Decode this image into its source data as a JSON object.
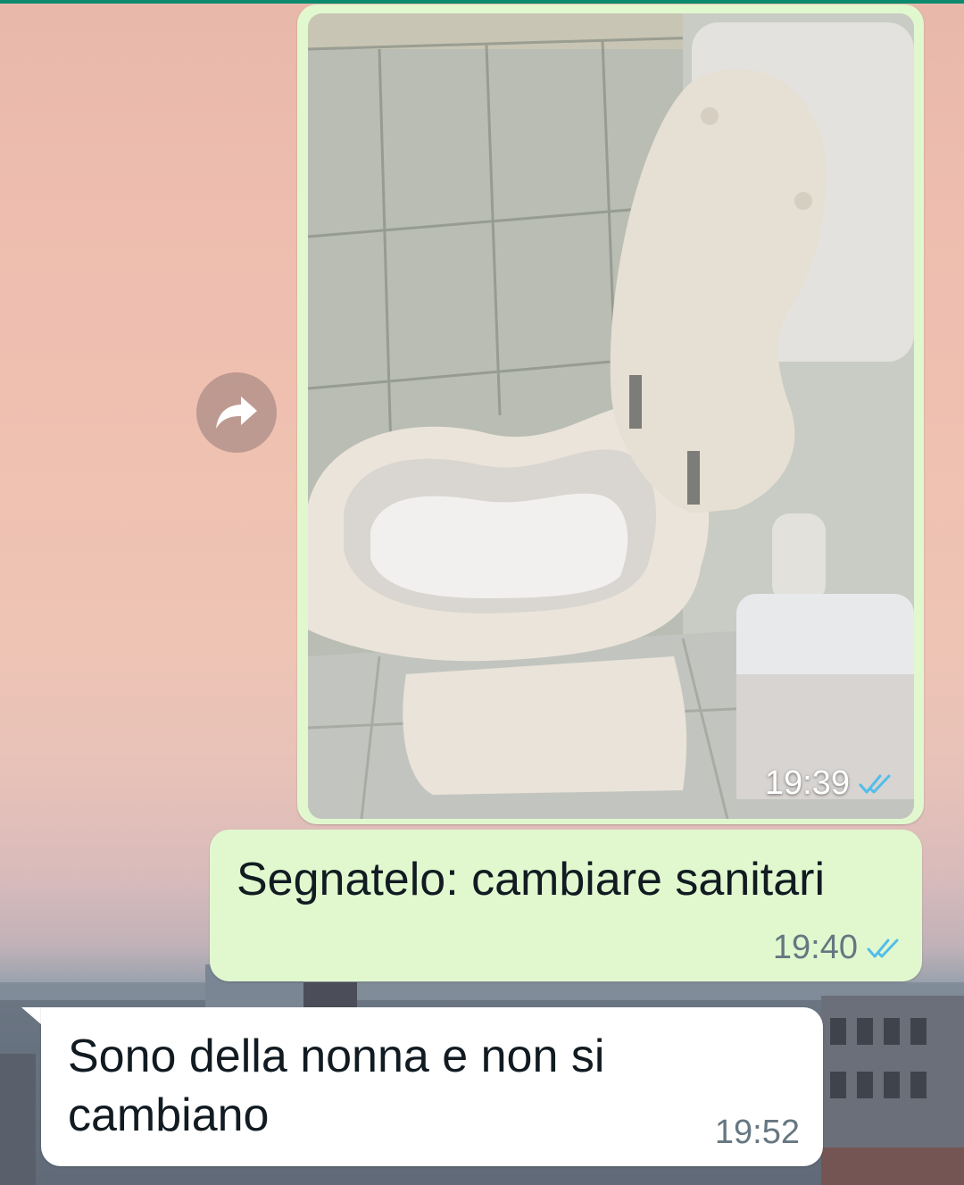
{
  "chat": {
    "messages": [
      {
        "type": "image",
        "direction": "outgoing",
        "time": "19:39",
        "status": "read",
        "status_icon": "double-check-icon"
      },
      {
        "type": "text",
        "direction": "outgoing",
        "text": "Segnatelo: cambiare sanitari",
        "time": "19:40",
        "status": "read",
        "status_icon": "double-check-icon"
      },
      {
        "type": "text",
        "direction": "incoming",
        "text": "Sono della nonna e non si cambiano",
        "time": "19:52"
      }
    ]
  },
  "icons": {
    "forward": "forward-arrow-icon"
  },
  "colors": {
    "outgoing_bubble": "#e1f8cf",
    "incoming_bubble": "#ffffff",
    "read_ticks": "#53bdeb",
    "meta_text": "#667781",
    "header_accent": "#0b8a6e"
  }
}
